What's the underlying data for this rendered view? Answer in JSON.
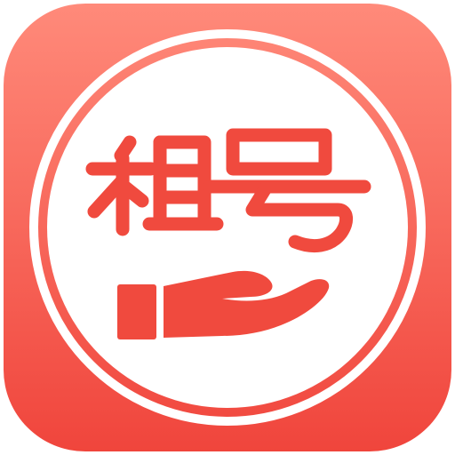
{
  "app_icon": {
    "logo_text": "租号",
    "icon": "hand-holding-icon",
    "colors": {
      "tile_top": "#ff8a7a",
      "tile_bottom": "#f0453c",
      "brand_red": "#f04a3e",
      "ring": "#ffffff",
      "disc": "#ffffff"
    }
  }
}
